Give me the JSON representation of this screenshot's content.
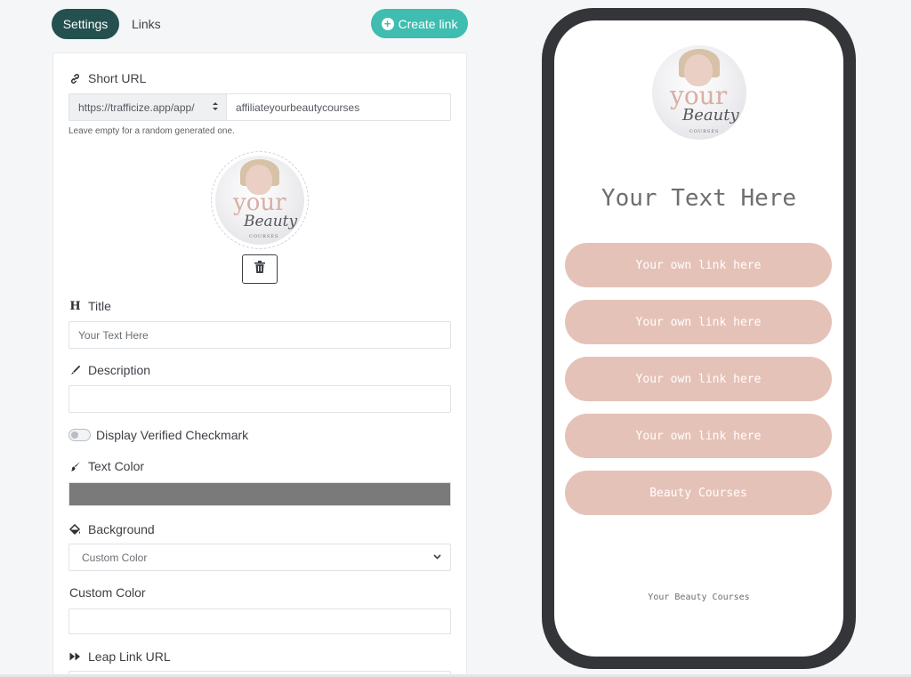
{
  "tabs": {
    "settings": "Settings",
    "links": "Links"
  },
  "create_button": {
    "label": "Create link",
    "icon": "plus-circle-icon",
    "color": "#3ebdb0"
  },
  "form": {
    "short_url": {
      "label": "Short URL",
      "icon": "link-icon",
      "prefix": "https://trafficize.app/app/",
      "value": "affiliateyourbeautycourses",
      "help": "Leave empty for a random generated one."
    },
    "logo": {
      "word1": "your",
      "word2": "Beauty",
      "word3": "COURSES"
    },
    "title": {
      "label": "Title",
      "icon": "heading-icon",
      "placeholder": "Your Text Here"
    },
    "description": {
      "label": "Description",
      "icon": "pen-icon",
      "value": ""
    },
    "verified": {
      "label": "Display Verified Checkmark",
      "enabled": false
    },
    "text_color": {
      "label": "Text Color",
      "icon": "brush-icon",
      "value": "#7a7a7a"
    },
    "background": {
      "label": "Background",
      "icon": "paint-bucket-icon",
      "selected": "Custom Color"
    },
    "custom_color": {
      "label": "Custom Color",
      "value": ""
    },
    "leap_link": {
      "label": "Leap Link URL",
      "icon": "fast-forward-icon"
    }
  },
  "preview": {
    "title": "Your Text Here",
    "links": [
      "Your own link here",
      "Your own link here",
      "Your own link here",
      "Your own link here",
      "Beauty Courses"
    ],
    "footer": "Your Beauty Courses",
    "button_color": "#e5c2b8"
  }
}
